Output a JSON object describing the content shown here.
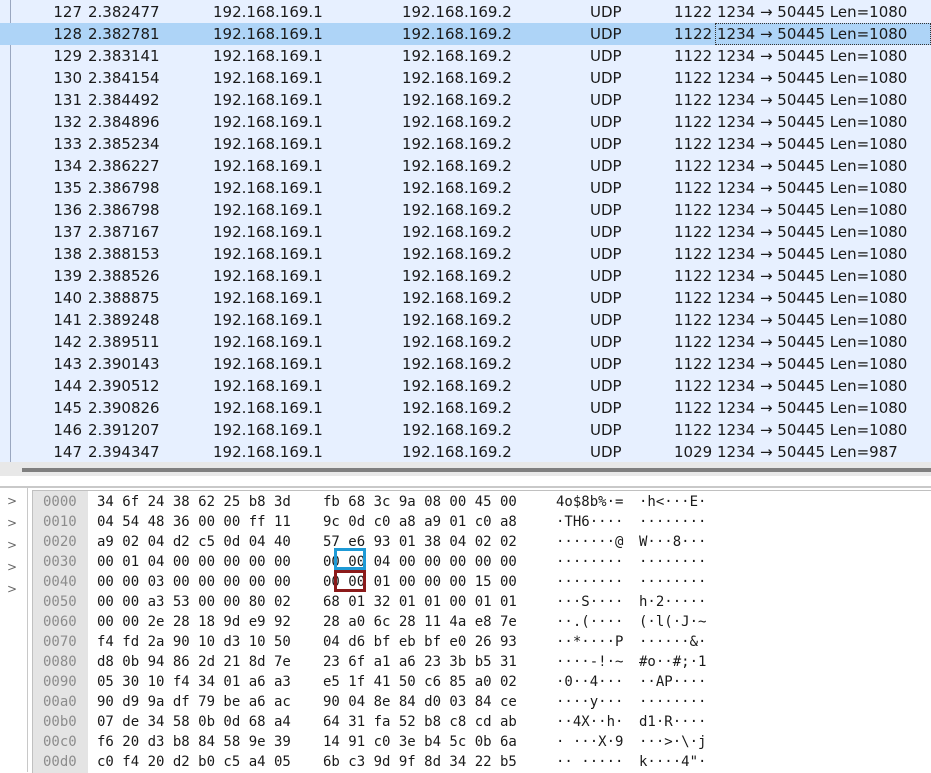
{
  "packet_list": {
    "selected_no": "128",
    "rows": [
      {
        "no": "127",
        "time": "2.382477",
        "src": "192.168.169.1",
        "dst": "192.168.169.2",
        "proto": "UDP",
        "len": "1122",
        "info": "1234 → 50445 Len=1080"
      },
      {
        "no": "128",
        "time": "2.382781",
        "src": "192.168.169.1",
        "dst": "192.168.169.2",
        "proto": "UDP",
        "len": "1122",
        "info": "1234 → 50445 Len=1080"
      },
      {
        "no": "129",
        "time": "2.383141",
        "src": "192.168.169.1",
        "dst": "192.168.169.2",
        "proto": "UDP",
        "len": "1122",
        "info": "1234 → 50445 Len=1080"
      },
      {
        "no": "130",
        "time": "2.384154",
        "src": "192.168.169.1",
        "dst": "192.168.169.2",
        "proto": "UDP",
        "len": "1122",
        "info": "1234 → 50445 Len=1080"
      },
      {
        "no": "131",
        "time": "2.384492",
        "src": "192.168.169.1",
        "dst": "192.168.169.2",
        "proto": "UDP",
        "len": "1122",
        "info": "1234 → 50445 Len=1080"
      },
      {
        "no": "132",
        "time": "2.384896",
        "src": "192.168.169.1",
        "dst": "192.168.169.2",
        "proto": "UDP",
        "len": "1122",
        "info": "1234 → 50445 Len=1080"
      },
      {
        "no": "133",
        "time": "2.385234",
        "src": "192.168.169.1",
        "dst": "192.168.169.2",
        "proto": "UDP",
        "len": "1122",
        "info": "1234 → 50445 Len=1080"
      },
      {
        "no": "134",
        "time": "2.386227",
        "src": "192.168.169.1",
        "dst": "192.168.169.2",
        "proto": "UDP",
        "len": "1122",
        "info": "1234 → 50445 Len=1080"
      },
      {
        "no": "135",
        "time": "2.386798",
        "src": "192.168.169.1",
        "dst": "192.168.169.2",
        "proto": "UDP",
        "len": "1122",
        "info": "1234 → 50445 Len=1080"
      },
      {
        "no": "136",
        "time": "2.386798",
        "src": "192.168.169.1",
        "dst": "192.168.169.2",
        "proto": "UDP",
        "len": "1122",
        "info": "1234 → 50445 Len=1080"
      },
      {
        "no": "137",
        "time": "2.387167",
        "src": "192.168.169.1",
        "dst": "192.168.169.2",
        "proto": "UDP",
        "len": "1122",
        "info": "1234 → 50445 Len=1080"
      },
      {
        "no": "138",
        "time": "2.388153",
        "src": "192.168.169.1",
        "dst": "192.168.169.2",
        "proto": "UDP",
        "len": "1122",
        "info": "1234 → 50445 Len=1080"
      },
      {
        "no": "139",
        "time": "2.388526",
        "src": "192.168.169.1",
        "dst": "192.168.169.2",
        "proto": "UDP",
        "len": "1122",
        "info": "1234 → 50445 Len=1080"
      },
      {
        "no": "140",
        "time": "2.388875",
        "src": "192.168.169.1",
        "dst": "192.168.169.2",
        "proto": "UDP",
        "len": "1122",
        "info": "1234 → 50445 Len=1080"
      },
      {
        "no": "141",
        "time": "2.389248",
        "src": "192.168.169.1",
        "dst": "192.168.169.2",
        "proto": "UDP",
        "len": "1122",
        "info": "1234 → 50445 Len=1080"
      },
      {
        "no": "142",
        "time": "2.389511",
        "src": "192.168.169.1",
        "dst": "192.168.169.2",
        "proto": "UDP",
        "len": "1122",
        "info": "1234 → 50445 Len=1080"
      },
      {
        "no": "143",
        "time": "2.390143",
        "src": "192.168.169.1",
        "dst": "192.168.169.2",
        "proto": "UDP",
        "len": "1122",
        "info": "1234 → 50445 Len=1080"
      },
      {
        "no": "144",
        "time": "2.390512",
        "src": "192.168.169.1",
        "dst": "192.168.169.2",
        "proto": "UDP",
        "len": "1122",
        "info": "1234 → 50445 Len=1080"
      },
      {
        "no": "145",
        "time": "2.390826",
        "src": "192.168.169.1",
        "dst": "192.168.169.2",
        "proto": "UDP",
        "len": "1122",
        "info": "1234 → 50445 Len=1080"
      },
      {
        "no": "146",
        "time": "2.391207",
        "src": "192.168.169.1",
        "dst": "192.168.169.2",
        "proto": "UDP",
        "len": "1122",
        "info": "1234 → 50445 Len=1080"
      },
      {
        "no": "147",
        "time": "2.394347",
        "src": "192.168.169.1",
        "dst": "192.168.169.2",
        "proto": "UDP",
        "len": "1029",
        "info": "1234 → 50445 Len=987"
      }
    ]
  },
  "details_pane": {
    "expander_icon": "chevron-right-icon",
    "expander_glyph": ">"
  },
  "bytes_pane": {
    "rows": [
      {
        "off": "0000",
        "b1": "34 6f 24 38 62 25 b8 3d",
        "b2": "fb 68 3c 9a 08 00 45 00",
        "a1": "4o$8b%·=",
        "a2": "·h<···E·"
      },
      {
        "off": "0010",
        "b1": "04 54 48 36 00 00 ff 11",
        "b2": "9c 0d c0 a8 a9 01 c0 a8",
        "a1": "·TH6····",
        "a2": "········"
      },
      {
        "off": "0020",
        "b1": "a9 02 04 d2 c5 0d 04 40",
        "b2": "57 e6 93 01 38 04 02 02",
        "a1": "·······@",
        "a2": "W···8···"
      },
      {
        "off": "0030",
        "b1": "00 01 04 00 00 00 00 00",
        "b2": "00 00 04 00 00 00 00 00",
        "a1": "········",
        "a2": "········"
      },
      {
        "off": "0040",
        "b1": "00 00 03 00 00 00 00 00",
        "b2": "00 00 01 00 00 00 15 00",
        "a1": "········",
        "a2": "········"
      },
      {
        "off": "0050",
        "b1": "00 00 a3 53 00 00 80 02",
        "b2": "68 01 32 01 01 00 01 01",
        "a1": "···S····",
        "a2": "h·2·····"
      },
      {
        "off": "0060",
        "b1": "00 00 2e 28 18 9d e9 92",
        "b2": "28 a0 6c 28 11 4a e8 7e",
        "a1": "··.(····",
        "a2": "(·l(·J·~"
      },
      {
        "off": "0070",
        "b1": "f4 fd 2a 90 10 d3 10 50",
        "b2": "04 d6 bf eb bf e0 26 93",
        "a1": "··*····P",
        "a2": "······&·"
      },
      {
        "off": "0080",
        "b1": "d8 0b 94 86 2d 21 8d 7e",
        "b2": "23 6f a1 a6 23 3b b5 31",
        "a1": "····-!·~",
        "a2": "#o··#;·1"
      },
      {
        "off": "0090",
        "b1": "05 30 10 f4 34 01 a6 a3",
        "b2": "e5 1f 41 50 c6 85 a0 02",
        "a1": "·0··4···",
        "a2": "··AP····"
      },
      {
        "off": "00a0",
        "b1": "90 d9 9a df 79 be a6 ac",
        "b2": "90 04 8e 84 d0 03 84 ce",
        "a1": "····y···",
        "a2": "········"
      },
      {
        "off": "00b0",
        "b1": "07 de 34 58 0b 0d 68 a4",
        "b2": "64 31 fa 52 b8 c8 cd ab",
        "a1": "··4X··h·",
        "a2": "d1·R····"
      },
      {
        "off": "00c0",
        "b1": "f6 20 d3 b8 84 58 9e 39",
        "b2": "14 91 c0 3e b4 5c 0b 6a",
        "a1": "· ···X·9",
        "a2": "···>·\\·j"
      },
      {
        "off": "00d0",
        "b1": "c0 f4 20 d2 b0 c5 a4 05",
        "b2": "6b c3 9d 9f 8d 34 22 b5",
        "a1": "·· ·····",
        "a2": "k····4\"·"
      }
    ],
    "highlight_blue": "#1e9ad6",
    "highlight_red": "#8b1a1a",
    "highlight_blue_byte": "04",
    "highlight_red_byte": "01"
  }
}
